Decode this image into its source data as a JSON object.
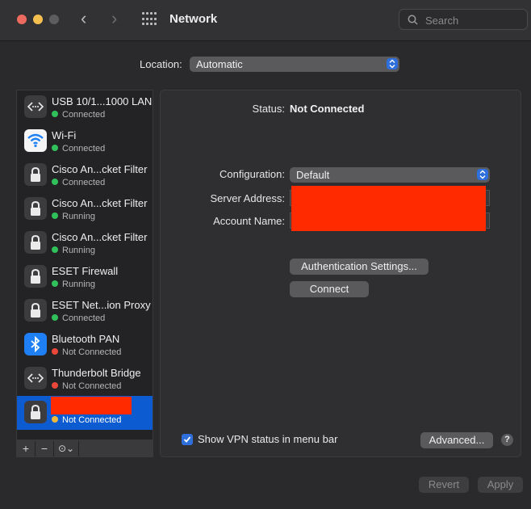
{
  "window": {
    "title": "Network"
  },
  "search": {
    "placeholder": "Search"
  },
  "location": {
    "label": "Location:",
    "value": "Automatic"
  },
  "services": [
    {
      "name": "USB 10/1...1000 LAN",
      "status": "Connected",
      "status_color": "#31c15a",
      "icon": "ethernet-icon"
    },
    {
      "name": "Wi-Fi",
      "status": "Connected",
      "status_color": "#31c15a",
      "icon": "wifi-icon"
    },
    {
      "name": "Cisco An...cket Filter",
      "status": "Connected",
      "status_color": "#31c15a",
      "icon": "lock-icon"
    },
    {
      "name": "Cisco An...cket Filter",
      "status": "Running",
      "status_color": "#31c15a",
      "icon": "lock-icon"
    },
    {
      "name": "Cisco An...cket Filter",
      "status": "Running",
      "status_color": "#31c15a",
      "icon": "lock-icon"
    },
    {
      "name": "ESET Firewall",
      "status": "Running",
      "status_color": "#31c15a",
      "icon": "lock-icon"
    },
    {
      "name": "ESET Net...ion Proxy",
      "status": "Connected",
      "status_color": "#31c15a",
      "icon": "lock-icon"
    },
    {
      "name": "Bluetooth PAN",
      "status": "Not Connected",
      "status_color": "#e8473a",
      "icon": "bluetooth-icon"
    },
    {
      "name": "Thunderbolt Bridge",
      "status": "Not Connected",
      "status_color": "#e8473a",
      "icon": "ethernet-icon"
    },
    {
      "name": "",
      "status": "Not Connected",
      "status_color": "#f0b93a",
      "icon": "lock-icon"
    }
  ],
  "sidebar_tools": {
    "add": "+",
    "remove": "−",
    "action": "⊙⌄"
  },
  "detail": {
    "status_label": "Status:",
    "status_value": "Not Connected",
    "configuration_label": "Configuration:",
    "configuration_value": "Default",
    "server_address_label": "Server Address:",
    "account_name_label": "Account Name:",
    "auth_button": "Authentication Settings...",
    "connect_button": "Connect",
    "show_vpn_label": "Show VPN status in menu bar",
    "advanced_button": "Advanced...",
    "help": "?"
  },
  "footer": {
    "revert": "Revert",
    "apply": "Apply"
  }
}
